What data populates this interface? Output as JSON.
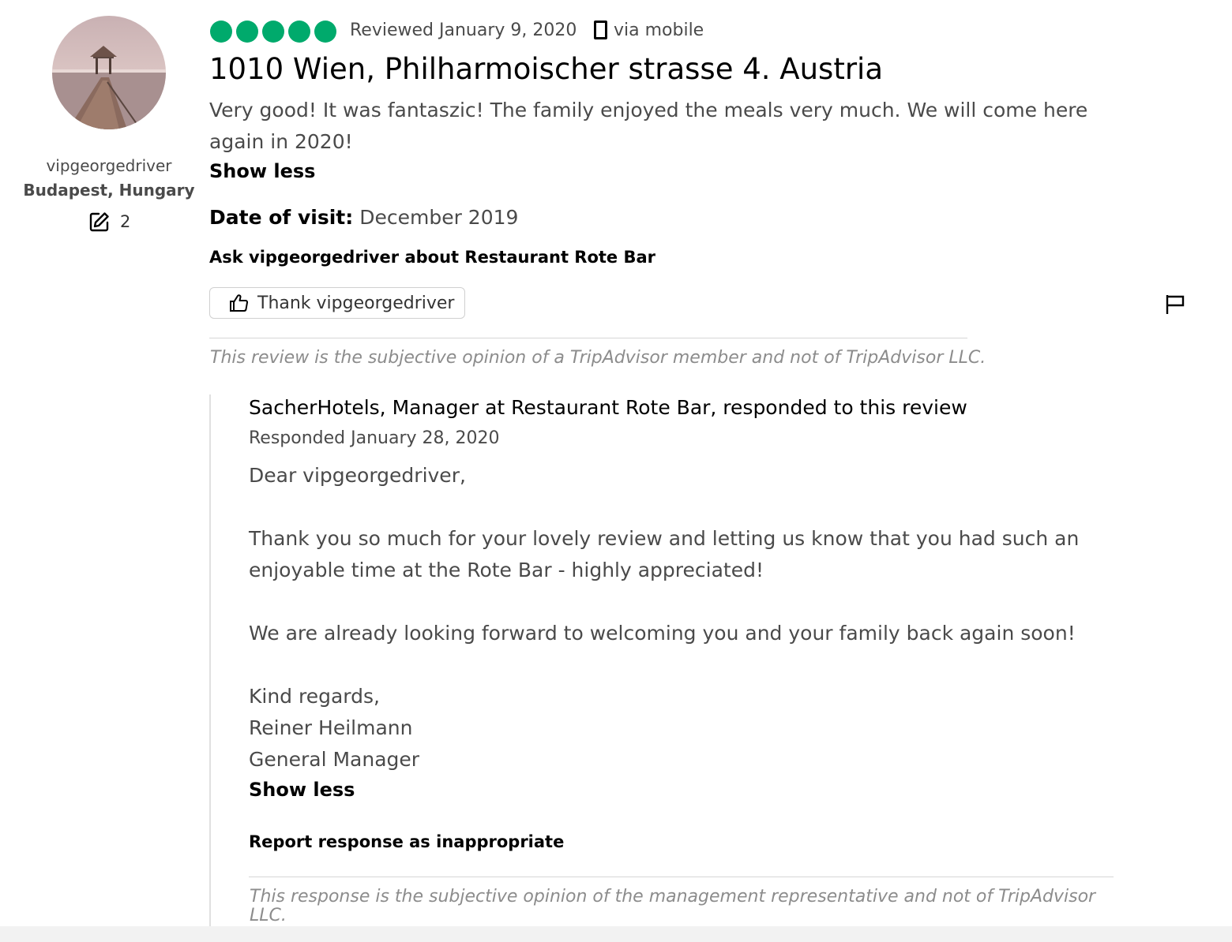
{
  "reviewer": {
    "username": "vipgeorgedriver",
    "location": "Budapest, Hungary",
    "contributions": "2",
    "avatar_icon": "avatar-photo"
  },
  "review": {
    "rating": 5,
    "rating_max": 5,
    "rating_color": "#00aa6c",
    "date": "Reviewed January 9, 2020",
    "device_icon": "phone-icon",
    "device": "via mobile",
    "title": "1010 Wien, Philharmoischer strasse 4. Austria",
    "body": "Very good! It was fantaszic! The family enjoyed the meals very much. We will come here again in 2020!",
    "show_less": "Show less",
    "visit_label": "Date of visit:",
    "visit_value": "December 2019",
    "ask": "Ask vipgeorgedriver about Restaurant Rote Bar",
    "thank_button": "Thank vipgeorgedriver",
    "disclaimer": "This review is the subjective opinion of a TripAdvisor member and not of TripAdvisor LLC."
  },
  "response": {
    "header": "SacherHotels, Manager at Restaurant Rote Bar, responded to this review",
    "date": "Responded January 28, 2020",
    "greeting": "Dear vipgeorgedriver,",
    "paragraph1": "Thank you so much for your lovely review and letting us know that you had such an enjoyable time at the Rote Bar - highly appreciated!",
    "paragraph2": "We are already looking forward to welcoming you and your family back again soon!",
    "closing": "Kind regards,",
    "signer_name": "Reiner Heilmann",
    "signer_title": "General Manager",
    "show_less": "Show less",
    "report": "Report response as inappropriate",
    "disclaimer": "This response is the subjective opinion of the management representative and not of TripAdvisor LLC."
  }
}
